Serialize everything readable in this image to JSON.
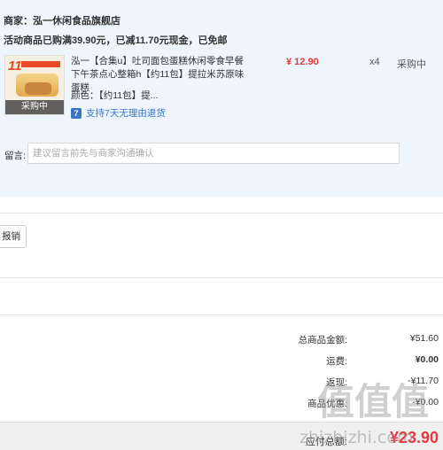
{
  "shop": {
    "merchant": "商家：泓一休闲食品旗舰店",
    "promo": "活动商品已购满39.90元，已减11.70元现金，已免邮"
  },
  "item": {
    "thumb_badge": "11",
    "thumb_status": "采购中",
    "title": "泓一【合集u】吐司面包蛋糕休闲零食早餐下午茶点心整箱h【约11包】提拉米苏原味蛋糕",
    "price": "¥ 12.90",
    "qty": "x4",
    "purchase_status": "采购中",
    "spec_label": "颜色：",
    "spec_value": "【约11包】提...",
    "return_icon": "7",
    "return_text": "支持7天无理由退货"
  },
  "message": {
    "label": "留言:",
    "placeholder": "建议留言前先与商家沟通确认"
  },
  "reimburse": {
    "label": "报销"
  },
  "summary": {
    "rows": [
      {
        "label": "总商品金额:",
        "value": "¥51.60"
      },
      {
        "label": "运费:",
        "value": "¥0.00"
      },
      {
        "label": "返现:",
        "value": "-¥11.70"
      },
      {
        "label": "商品优惠:",
        "value": "-¥0.00"
      }
    ],
    "total_label": "应付总额:",
    "total_value": "¥23.90"
  },
  "watermark": {
    "glyphs": "值值值",
    "url": "zhizhizhi.com"
  },
  "colors": {
    "panel_bg": "#eef5fc",
    "price_red": "#e4393c",
    "link_blue": "#3b73c4"
  }
}
